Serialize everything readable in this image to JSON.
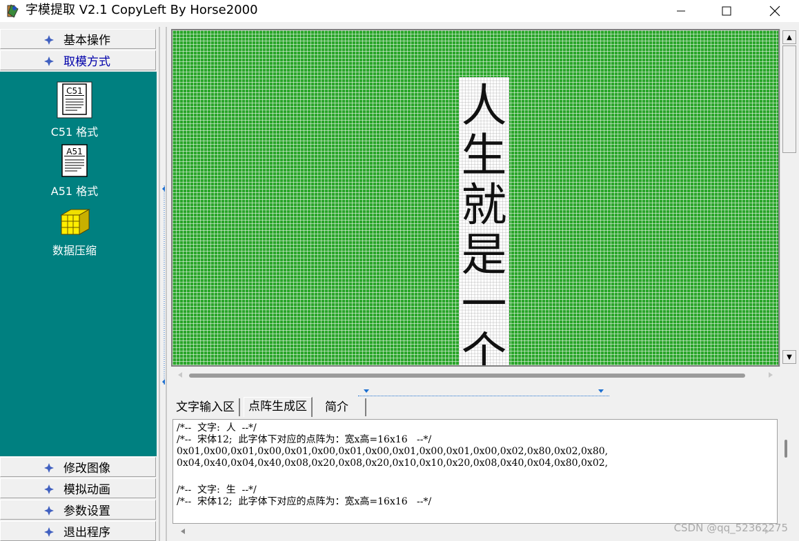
{
  "window": {
    "title": "字模提取 V2.1  CopyLeft By Horse2000",
    "controls": {
      "minimize": "—",
      "maximize": "☐",
      "close": "✕"
    }
  },
  "sidebar": {
    "top_buttons": [
      {
        "label": "基本操作"
      },
      {
        "label": "取模方式"
      }
    ],
    "tools": [
      {
        "label": "C51 格式",
        "icon_text": "C51",
        "icon": "c51-document-icon"
      },
      {
        "label": "A51 格式",
        "icon_text": "A51",
        "icon": "a51-document-icon"
      },
      {
        "label": "数据压缩",
        "icon": "data-compress-icon"
      }
    ],
    "bottom_buttons": [
      {
        "label": "修改图像"
      },
      {
        "label": "模拟动画"
      },
      {
        "label": "参数设置"
      },
      {
        "label": "退出程序"
      }
    ]
  },
  "grid": {
    "characters": [
      "人",
      "生",
      "就",
      "是",
      "一",
      "个"
    ]
  },
  "tabs": [
    {
      "label": "文字输入区"
    },
    {
      "label": "点阵生成区"
    },
    {
      "label": "简介"
    }
  ],
  "output": {
    "lines": [
      "/*--  文字:  人  --*/",
      "/*--  宋体12;  此字体下对应的点阵为：宽x高=16x16   --*/",
      "0x01,0x00,0x01,0x00,0x01,0x00,0x01,0x00,0x01,0x00,0x01,0x00,0x02,0x80,0x02,0x80,",
      "0x04,0x40,0x04,0x40,0x08,0x20,0x08,0x20,0x10,0x10,0x20,0x08,0x40,0x04,0x80,0x02,",
      "",
      "/*--  文字:  生  --*/",
      "/*--  宋体12;  此字体下对应的点阵为：宽x高=16x16   --*/"
    ]
  },
  "watermark": "CSDN @qq_52362275",
  "colors": {
    "teal": "#008080",
    "grid_green": "#2aa52a",
    "accent_blue": "#0000aa"
  }
}
